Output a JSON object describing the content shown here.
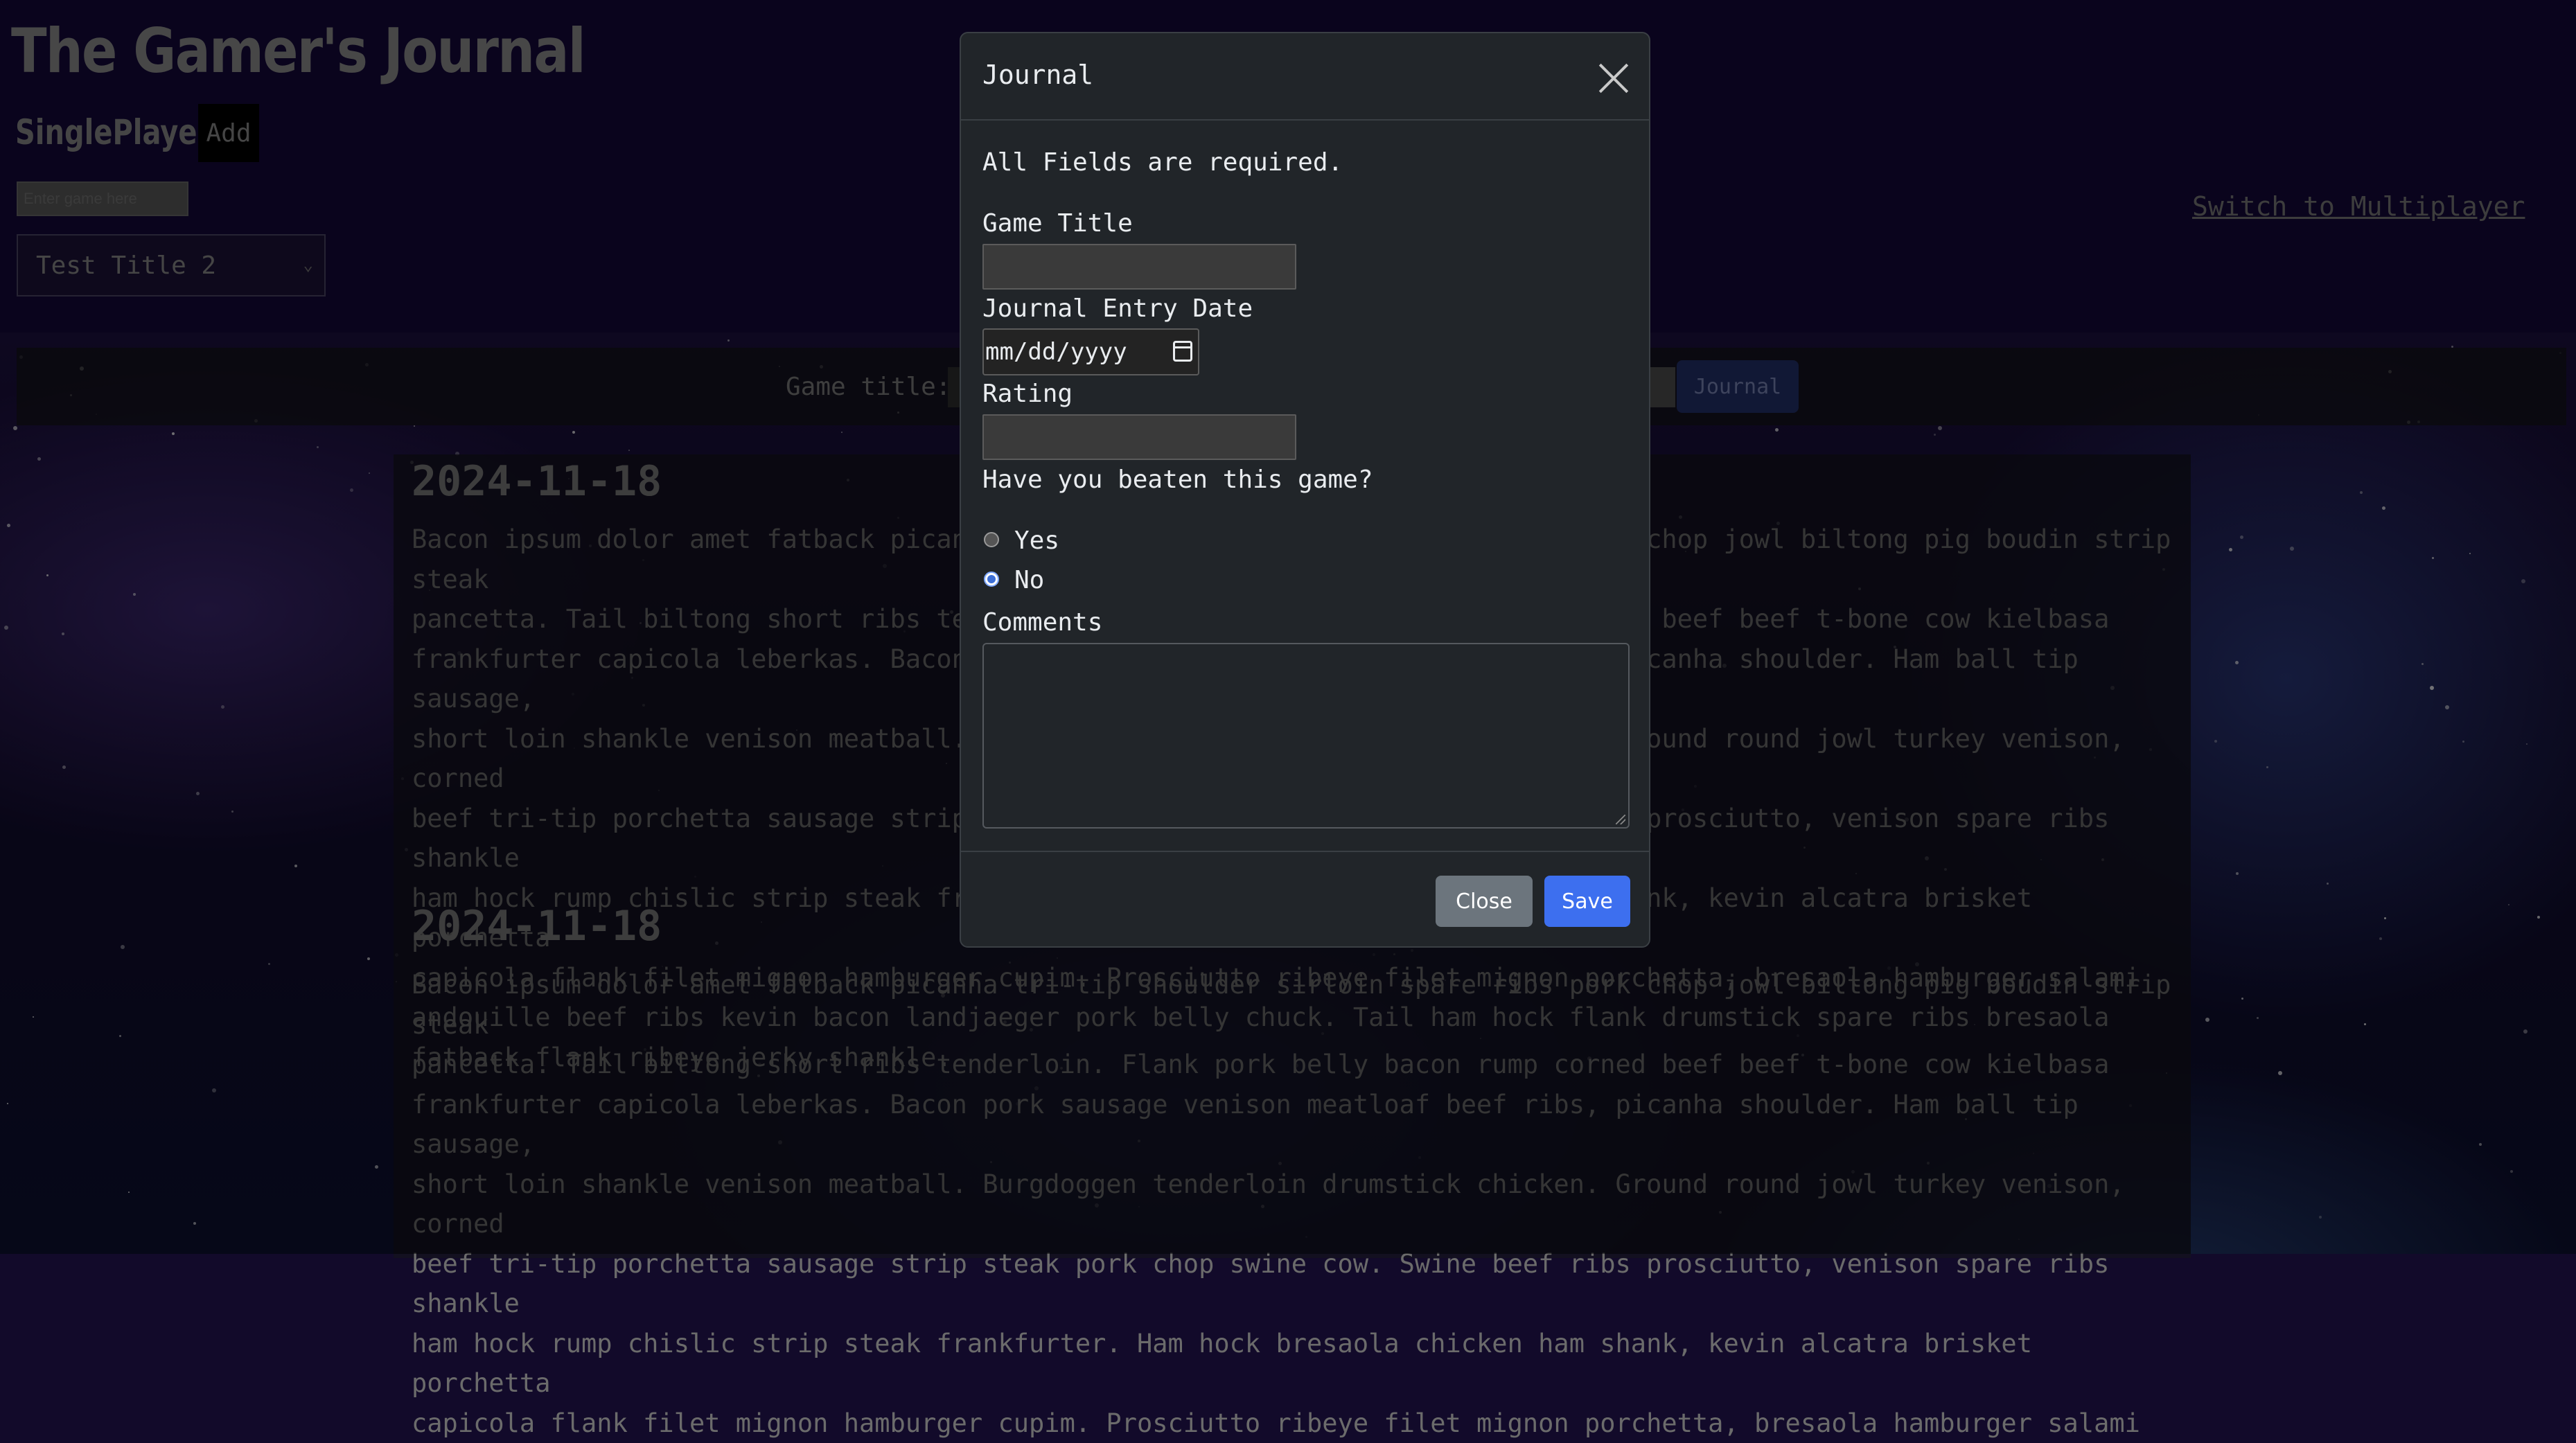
{
  "app": {
    "title": "The Gamer's Journal",
    "mode_label": "SinglePlayer",
    "add_label": "Add",
    "game_input_placeholder": "Enter game here",
    "selected_game": "Test Title 2",
    "switch_link": "Switch to Multiplayer"
  },
  "toolbar": {
    "game_title_label": "Game title:",
    "journal_button": "Journal"
  },
  "entries": [
    {
      "date": "2024-11-18",
      "lines": [
        "Bacon ipsum dolor amet fatback picanha tri-tip shoulder sirloin spare ribs pork chop jowl biltong pig boudin strip steak",
        "pancetta. Tail biltong short ribs tenderloin. Flank pork belly bacon rump corned beef beef t-bone cow kielbasa",
        "frankfurter capicola leberkas. Bacon pork sausage venison meatloaf beef ribs, picanha shoulder. Ham ball tip sausage,",
        "short loin shankle venison meatball. Burgdoggen tenderloin drumstick chicken. Ground round jowl turkey venison, corned",
        "beef tri-tip porchetta sausage strip steak pork chop swine cow. Swine beef ribs prosciutto, venison spare ribs shankle",
        "ham hock rump chislic strip steak frankfurter. Ham hock bresaola chicken ham shank, kevin alcatra brisket porchetta",
        "capicola flank filet mignon hamburger cupim. Prosciutto ribeye filet mignon porchetta, bresaola hamburger salami",
        "andouille beef ribs kevin bacon landjaeger pork belly chuck. Tail ham hock flank drumstick spare ribs bresaola",
        "fatback flank ribeye jerky shankle."
      ]
    },
    {
      "date": "2024-11-18",
      "lines": [
        "Bacon ipsum dolor amet fatback picanha tri-tip shoulder sirloin spare ribs pork chop jowl biltong pig boudin strip steak",
        "pancetta. Tail biltong short ribs tenderloin. Flank pork belly bacon rump corned beef beef t-bone cow kielbasa",
        "frankfurter capicola leberkas. Bacon pork sausage venison meatloaf beef ribs, picanha shoulder. Ham ball tip sausage,",
        "short loin shankle venison meatball. Burgdoggen tenderloin drumstick chicken. Ground round jowl turkey venison, corned",
        "beef tri-tip porchetta sausage strip steak pork chop swine cow. Swine beef ribs prosciutto, venison spare ribs shankle",
        "ham hock rump chislic strip steak frankfurter. Ham hock bresaola chicken ham shank, kevin alcatra brisket porchetta",
        "capicola flank filet mignon hamburger cupim. Prosciutto ribeye filet mignon porchetta, bresaola hamburger salami"
      ]
    }
  ],
  "modal": {
    "title": "Journal",
    "required_note": "All Fields are required.",
    "game_title_label": "Game Title",
    "date_label": "Journal Entry Date",
    "date_placeholder": "mm/dd/yyyy",
    "rating_label": "Rating",
    "beaten_question": "Have you beaten this game?",
    "option_yes": "Yes",
    "option_no": "No",
    "selected_option": "No",
    "comments_label": "Comments",
    "close_button": "Close",
    "save_button": "Save"
  },
  "colors": {
    "primary": "#3d6fef",
    "secondary": "#6c757d",
    "modal_bg": "#212529"
  }
}
